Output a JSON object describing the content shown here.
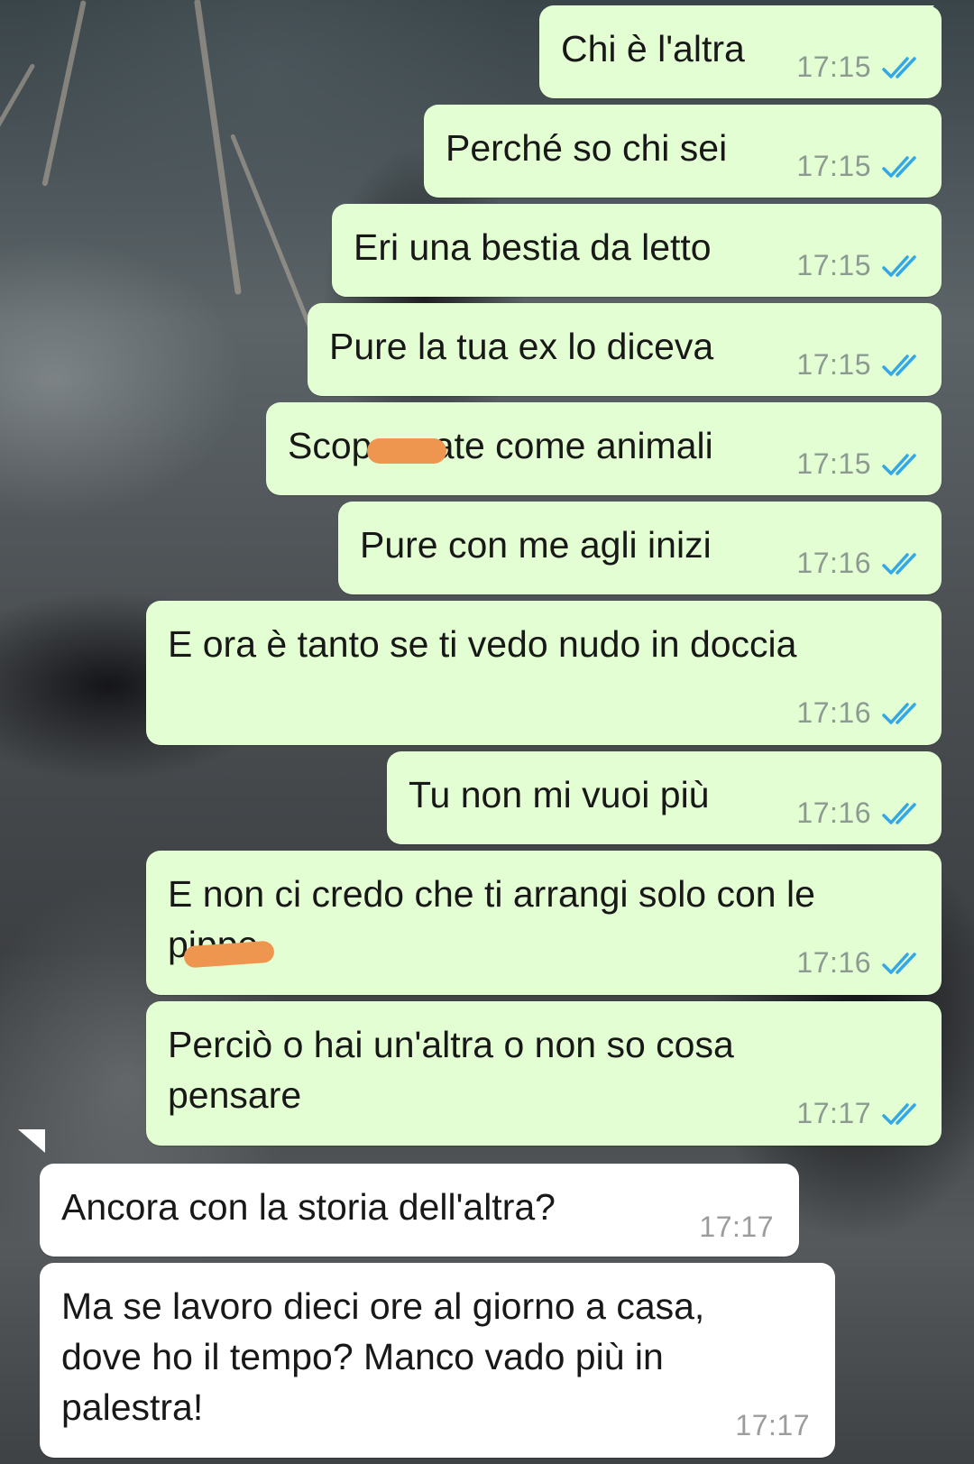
{
  "colors": {
    "outgoing_bubble": "#e3fed2",
    "incoming_bubble": "#ffffff",
    "read_tick": "#34a7e6",
    "redaction": "#ee9550"
  },
  "icons": {
    "read_receipt": "double-check-icon"
  },
  "messages": [
    {
      "direction": "outgoing",
      "text": "Chi è l'altra",
      "time": "17:15",
      "status": "read"
    },
    {
      "direction": "outgoing",
      "text": "Perché so chi sei",
      "time": "17:15",
      "status": "read"
    },
    {
      "direction": "outgoing",
      "text": "Eri una bestia da letto",
      "time": "17:15",
      "status": "read"
    },
    {
      "direction": "outgoing",
      "text": "Pure la tua ex lo diceva",
      "time": "17:15",
      "status": "read"
    },
    {
      "direction": "outgoing",
      "text": "Scop      ate come animali",
      "time": "17:15",
      "status": "read"
    },
    {
      "direction": "outgoing",
      "text": "Pure con me agli inizi",
      "time": "17:16",
      "status": "read"
    },
    {
      "direction": "outgoing",
      "text": "E ora è tanto se ti vedo nudo in doccia",
      "time": "17:16",
      "status": "read"
    },
    {
      "direction": "outgoing",
      "text": "Tu non mi vuoi più",
      "time": "17:16",
      "status": "read"
    },
    {
      "direction": "outgoing",
      "text": "E non ci credo che ti arrangi solo con le\npippe",
      "time": "17:16",
      "status": "read"
    },
    {
      "direction": "outgoing",
      "text": "Perciò o hai un'altra o non so cosa\npensare",
      "time": "17:17",
      "status": "read"
    },
    {
      "direction": "incoming",
      "text": "Ancora con la storia dell'altra?",
      "time": "17:17"
    },
    {
      "direction": "incoming",
      "text": "Ma se lavoro dieci ore al giorno a casa,\ndove ho il tempo? Manco vado più in\npalestra!",
      "time": "17:17"
    }
  ]
}
